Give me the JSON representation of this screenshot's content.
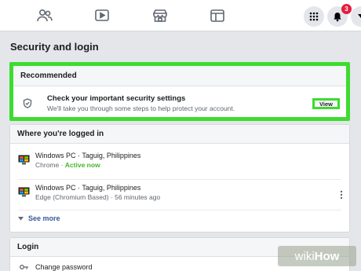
{
  "topbar": {
    "icons": [
      "friends-icon",
      "watch-icon",
      "marketplace-icon",
      "groups-icon"
    ],
    "notification_count": "3"
  },
  "page": {
    "title": "Security and login"
  },
  "recommended": {
    "header": "Recommended",
    "title": "Check your important security settings",
    "subtitle": "We'll take you through some steps to help protect your account.",
    "view_label": "View"
  },
  "logged_in": {
    "header": "Where you're logged in",
    "sessions": [
      {
        "device": "Windows PC · Taguig, Philippines",
        "browser": "Chrome · ",
        "status": "Active now"
      },
      {
        "device": "Windows PC · Taguig, Philippines",
        "browser": "Edge (Chromium Based) · 56 minutes ago",
        "status": ""
      }
    ],
    "see_more": "See more"
  },
  "login": {
    "header": "Login",
    "change_password": "Change password"
  },
  "watermark": {
    "wiki": "wiki",
    "how": "How"
  },
  "colors": {
    "highlight": "#3ddc2f",
    "active": "#42b72a",
    "badge": "#e41e3f",
    "link": "#385898"
  }
}
